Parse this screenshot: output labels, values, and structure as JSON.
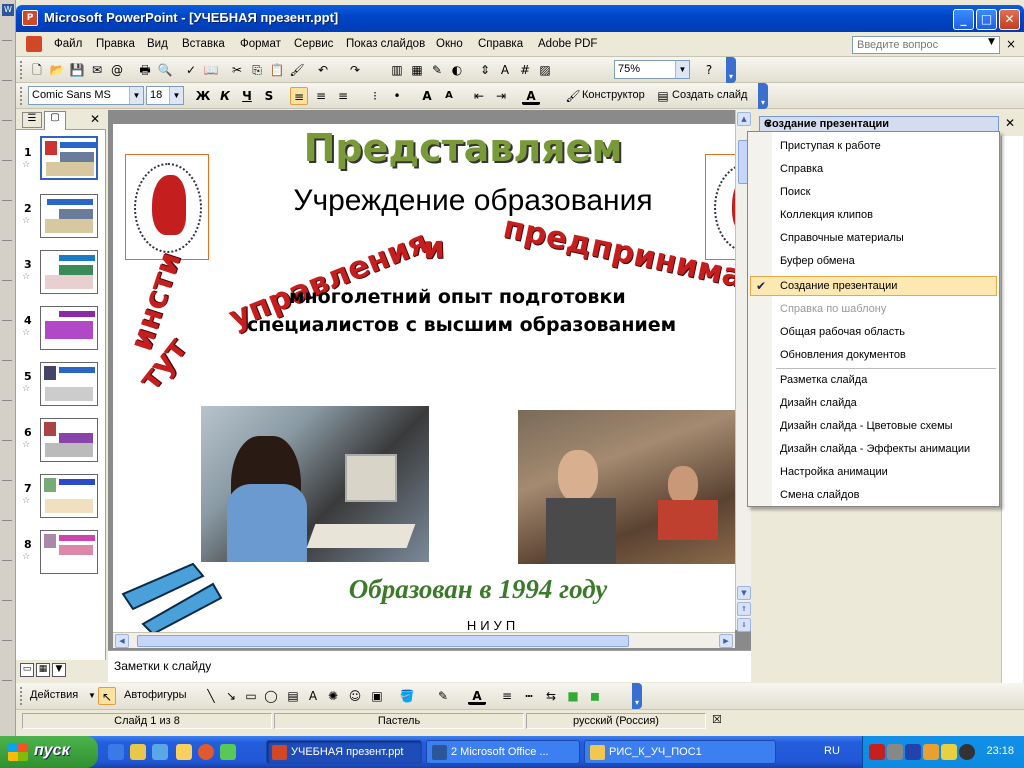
{
  "window": {
    "title": "Microsoft PowerPoint - [УЧЕБНАЯ презент.ppt]"
  },
  "menu": {
    "items": [
      "Файл",
      "Правка",
      "Вид",
      "Вставка",
      "Формат",
      "Сервис",
      "Показ слайдов",
      "Окно",
      "Справка",
      "Adobe PDF"
    ],
    "help_placeholder": "Введите вопрос"
  },
  "toolbar_standard": {
    "zoom": "75%"
  },
  "toolbar_format": {
    "font": "Comic Sans MS",
    "size": "18",
    "bold": "Ж",
    "italic": "К",
    "underline": "Ч",
    "shadow": "S",
    "designer": "Конструктор",
    "new_slide": "Создать слайд"
  },
  "slides_panel": {
    "numbers": [
      "1",
      "2",
      "3",
      "4",
      "5",
      "6",
      "7",
      "8"
    ]
  },
  "slide": {
    "title": "Представляем",
    "subtitle": "Учреждение образования",
    "arc_text": "институт управления и предпринимат",
    "body_line1": "многолетний опыт подготовки",
    "body_line2": "специалистов с высшим образованием",
    "founded": "Образован в 1994 году",
    "footer": "НИУП",
    "logo_text": "ИНСТИТУТ УПРАВЛЕНИЯ И ПРЕДПРИНИМАТЕЛЬСТВА"
  },
  "notes": {
    "placeholder": "Заметки к слайду"
  },
  "task_pane": {
    "title": "Создание презентации",
    "menu_items": [
      {
        "label": "Приступая к работе"
      },
      {
        "label": "Справка"
      },
      {
        "label": "Поиск"
      },
      {
        "label": "Коллекция клипов"
      },
      {
        "label": "Справочные материалы"
      },
      {
        "label": "Буфер обмена"
      },
      {
        "label": "Создание презентации"
      },
      {
        "label": "Справка по шаблону"
      },
      {
        "label": "Общая рабочая область"
      },
      {
        "label": "Обновления документов"
      },
      {
        "label": "Разметка слайда"
      },
      {
        "label": "Дизайн слайда"
      },
      {
        "label": "Дизайн слайда - Цветовые схемы"
      },
      {
        "label": "Дизайн слайда - Эффекты анимации"
      },
      {
        "label": "Настройка анимации"
      },
      {
        "label": "Смена слайдов"
      }
    ],
    "selected": "Создание презентации"
  },
  "draw_toolbar": {
    "actions": "Действия",
    "autoshapes": "Автофигуры"
  },
  "status": {
    "slide": "Слайд 1 из 8",
    "design": "Пастель",
    "language": "русский (Россия)"
  },
  "taskbar": {
    "start": "пуск",
    "tasks": [
      "УЧЕБНАЯ презент.ppt",
      "2 Microsoft Office ...",
      "РИС_К_УЧ_ПОС1"
    ],
    "lang": "RU",
    "clock": "23:18"
  },
  "colors": {
    "title_green": "#7a9a3a",
    "arc_red": "#c41e1e",
    "founded_green": "#3a7a28",
    "xp_blue": "#245edb"
  }
}
